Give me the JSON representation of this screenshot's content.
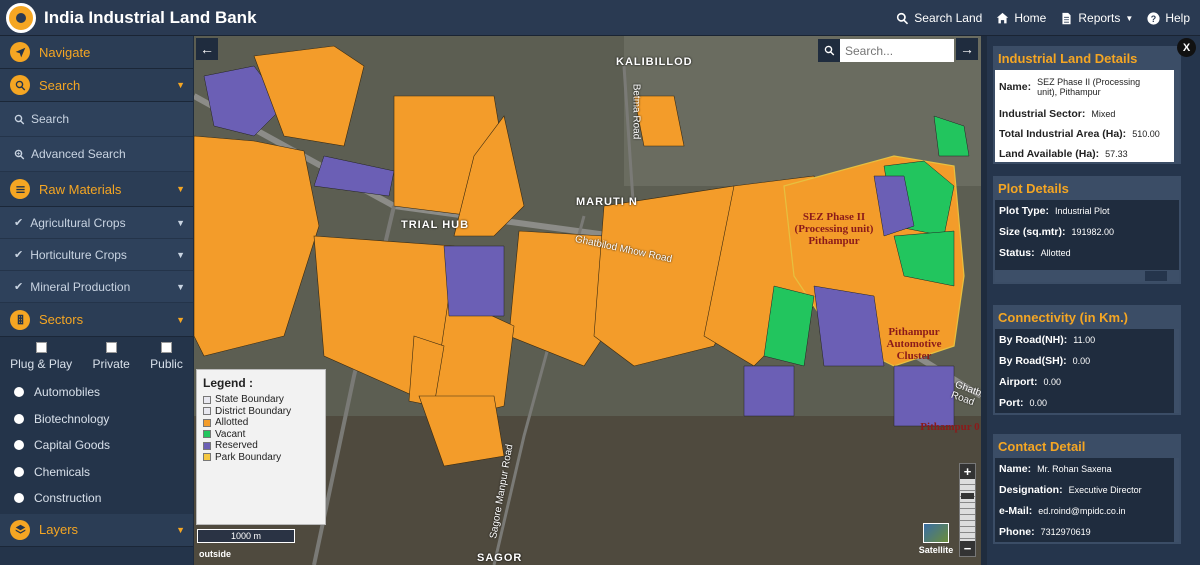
{
  "app": {
    "title": "India Industrial Land Bank"
  },
  "topnav": {
    "search_land": "Search Land",
    "home": "Home",
    "reports": "Reports",
    "help": "Help"
  },
  "sidebar": {
    "navigate": "Navigate",
    "search": "Search",
    "search_sub": "Search",
    "advanced_search": "Advanced Search",
    "raw_materials": "Raw Materials",
    "agricultural_crops": "Agricultural Crops",
    "horticulture_crops": "Horticulture Crops",
    "mineral_production": "Mineral Production",
    "sectors": "Sectors",
    "checks": [
      "Plug & Play",
      "Private",
      "Public"
    ],
    "sector_items": [
      "Automobiles",
      "Biotechnology",
      "Capital Goods",
      "Chemicals",
      "Construction"
    ],
    "layers": "Layers"
  },
  "map": {
    "search_placeholder": "Search...",
    "labels": {
      "kalibillod": "KALIBILLOD",
      "maruti": "MARUTI N",
      "hub": "TRIAL HUB",
      "sagor": "SAGOR",
      "ghatbilod_road": "Ghatbilod Mhow Road",
      "betma_road": "Betma Road",
      "sagore_road": "Sagore Manpur Road",
      "ghatbilod_road2": "Ghatbilod Road"
    },
    "sez_labels": {
      "sez1": "SEZ Phase II (Processing unit) Pithampur",
      "pithampur": "Pithampur Automotive Cluster",
      "pithampur2": "Pithampur 0"
    },
    "legend": {
      "title": "Legend :",
      "items": [
        {
          "label": "State Boundary",
          "color": "#e8e8f0"
        },
        {
          "label": "District Boundary",
          "color": "#e8e8f0"
        },
        {
          "label": "Allotted",
          "color": "#f39c2a"
        },
        {
          "label": "Vacant",
          "color": "#22c55e"
        },
        {
          "label": "Reserved",
          "color": "#6b5fb5"
        },
        {
          "label": "Park Boundary",
          "color": "#f5c842"
        }
      ]
    },
    "scale": "1000 m",
    "outside": "outside",
    "satellite": "Satellite",
    "zoom_in": "+",
    "zoom_out": "−"
  },
  "details": {
    "close": "X",
    "industrial": {
      "title": "Industrial Land Details",
      "name_k": "Name:",
      "name_v": "SEZ Phase II (Processing unit), Pithampur",
      "sector_k": "Industrial Sector:",
      "sector_v": "Mixed",
      "area_k": "Total Industrial Area (Ha):",
      "area_v": "510.00",
      "avail_k": "Land Available (Ha):",
      "avail_v": "57.33"
    },
    "plot": {
      "title": "Plot Details",
      "type_k": "Plot Type:",
      "type_v": "Industrial Plot",
      "size_k": "Size (sq.mtr):",
      "size_v": "191982.00",
      "status_k": "Status:",
      "status_v": "Allotted"
    },
    "connectivity": {
      "title": "Connectivity (in Km.)",
      "nh_k": "By Road(NH):",
      "nh_v": "11.00",
      "sh_k": "By Road(SH):",
      "sh_v": "0.00",
      "airport_k": "Airport:",
      "airport_v": "0.00",
      "port_k": "Port:",
      "port_v": "0.00"
    },
    "contact": {
      "title": "Contact Detail",
      "name_k": "Name:",
      "name_v": "Mr. Rohan Saxena",
      "desig_k": "Designation:",
      "desig_v": "Executive Director",
      "email_k": "e-Mail:",
      "email_v": "ed.roind@mpidc.co.in",
      "phone_k": "Phone:",
      "phone_v": "7312970619"
    }
  }
}
